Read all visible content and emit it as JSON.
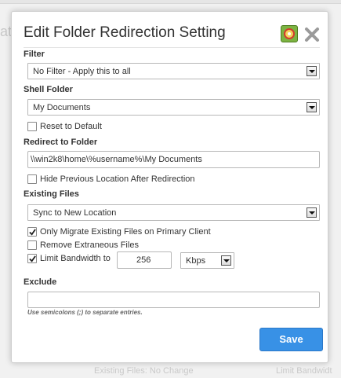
{
  "dialog": {
    "title": "Edit Folder Redirection Setting",
    "help_icon": "help-lifebuoy-icon",
    "close_icon": "close-icon"
  },
  "filter": {
    "label": "Filter",
    "selected": "No Filter - Apply this to all"
  },
  "shell_folder": {
    "label": "Shell Folder",
    "selected": "My Documents",
    "reset_label": "Reset to Default",
    "reset_checked": false
  },
  "redirect": {
    "label": "Redirect to Folder",
    "path": "\\\\win2k8\\home\\%username%\\My Documents",
    "hide_previous_label": "Hide Previous Location After Redirection",
    "hide_previous_checked": false
  },
  "existing_files": {
    "label": "Existing Files",
    "selected": "Sync to New Location",
    "only_migrate_label": "Only Migrate Existing Files on Primary Client",
    "only_migrate_checked": true,
    "remove_extraneous_label": "Remove Extraneous Files",
    "remove_extraneous_checked": false,
    "limit_bandwidth_label": "Limit Bandwidth to",
    "limit_bandwidth_checked": true,
    "bandwidth_value": "256",
    "bandwidth_unit": "Kbps"
  },
  "exclude": {
    "label": "Exclude",
    "value": "",
    "hint": "Use semicolons (;) to separate entries."
  },
  "actions": {
    "save_label": "Save"
  },
  "background": {
    "heading_fragment": "at",
    "bottom_text_1": "Existing Files: No Change",
    "bottom_text_2": "Limit Bandwidt"
  },
  "colors": {
    "primary_button": "#3891e6",
    "dialog_bg": "#ffffff",
    "page_bg": "#f1f1f1"
  }
}
